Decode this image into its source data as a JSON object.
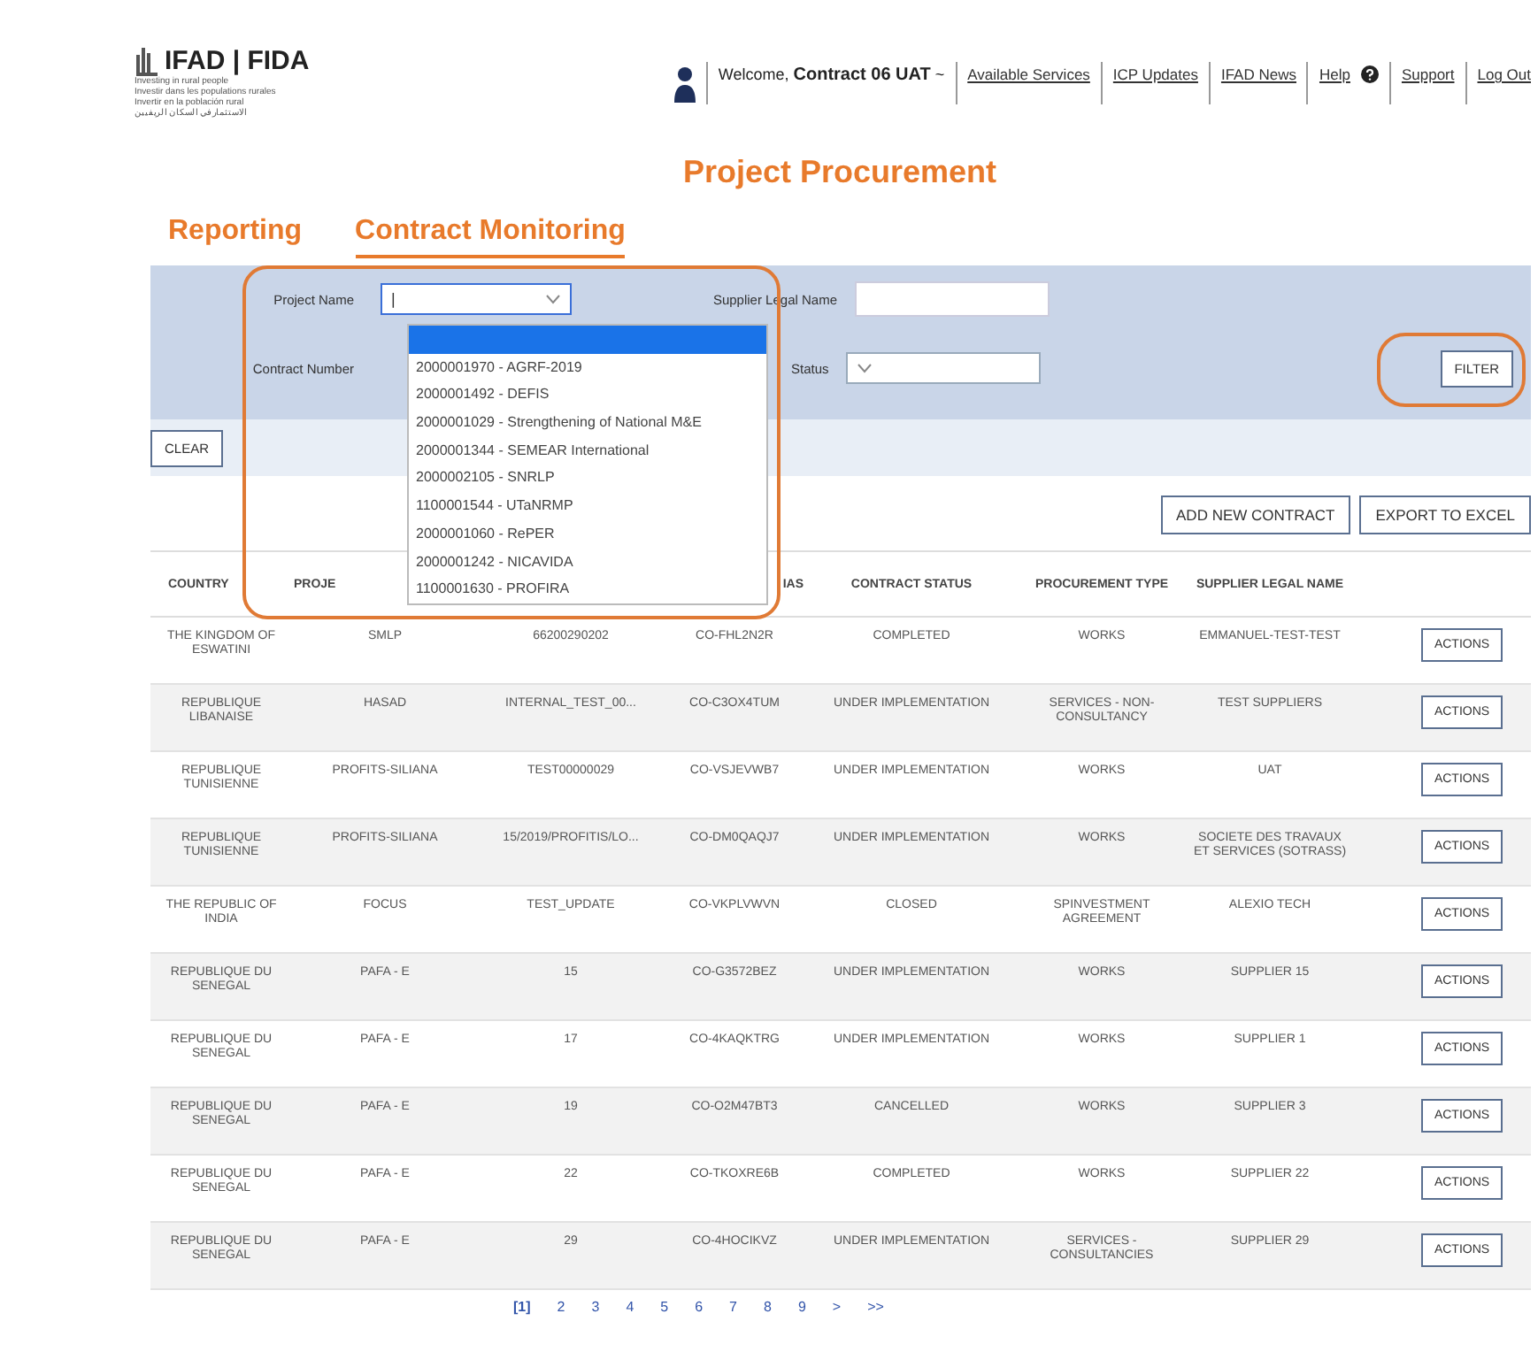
{
  "header": {
    "logo": "IFAD | FIDA",
    "taglines": [
      "Investing in rural people",
      "Investir dans les populations rurales",
      "Invertir en la población rural",
      "الاستثمار في السكان الريفيين"
    ],
    "welcome": "Welcome, **Contract 06 UAT** ~",
    "links": [
      "Available Services",
      "ICP Updates",
      "IFAD News",
      "Help",
      "Support",
      "Log Out"
    ]
  },
  "title": "Project Procurement",
  "tabs": [
    {
      "label": "Reporting",
      "selected": false
    },
    {
      "label": "Contract Monitoring",
      "selected": true
    }
  ],
  "filters": {
    "project_name": {
      "label": "Project Name",
      "value": "|"
    },
    "supplier_legal_name": {
      "label": "Supplier Legal Name"
    },
    "contract_number": {
      "label": "Contract Number"
    },
    "status": {
      "label": "Status"
    },
    "filter_button": "FILTER",
    "clear_button": "CLEAR",
    "dropdown_options": [
      {
        "selected": true
      },
      {
        "label": "2000001970 - AGRF-2019",
        "selected": false
      },
      {
        "label": "2000001492 - DEFIS",
        "selected": false
      },
      {
        "label": "2000001029 - Strengthening of National M&E",
        "selected": false
      },
      {
        "label": "2000001344 - SEMEAR International",
        "selected": false
      },
      {
        "label": "2000002105 - SNRLP",
        "selected": false
      },
      {
        "label": "1100001544 - UTaNRMP",
        "selected": false
      },
      {
        "label": "2000001060 - RePER",
        "selected": false
      },
      {
        "label": "2000001242 - NICAVIDA",
        "selected": false
      },
      {
        "label": "1100001630 - PROFIRA",
        "selected": false
      }
    ]
  },
  "actions": [
    "ADD NEW CONTRACT",
    "EXPORT TO EXCEL"
  ],
  "table": {
    "columns": [
      {
        "label": "COUNTRY"
      },
      {
        "label": "PROJE"
      },
      {},
      {
        "label": "IAS"
      },
      {
        "label": "CONTRACT STATUS"
      },
      {
        "label": "PROCUREMENT TYPE"
      },
      {
        "label": "SUPPLIER LEGAL NAME"
      },
      {}
    ],
    "rows": [
      [
        "THE KINGDOM OF ESWATINI",
        "SMLP",
        "66200290202",
        "CO-FHL2N2R",
        "COMPLETED",
        "WORKS",
        "EMMANUEL-TEST-TEST",
        "ACTIONS"
      ],
      [
        "REPUBLIQUE LIBANAISE",
        "HASAD",
        "INTERNAL_TEST_00...",
        "CO-C3OX4TUM",
        "UNDER IMPLEMENTATION",
        "SERVICES - NON-CONSULTANCY",
        "TEST SUPPLIERS",
        "ACTIONS"
      ],
      [
        "REPUBLIQUE TUNISIENNE",
        "PROFITS-SILIANA",
        "TEST00000029",
        "CO-VSJEVWB7",
        "UNDER IMPLEMENTATION",
        "WORKS",
        "UAT",
        "ACTIONS"
      ],
      [
        "REPUBLIQUE TUNISIENNE",
        "PROFITS-SILIANA",
        "15/2019/PROFITIS/LO...",
        "CO-DM0QAQJ7",
        "UNDER IMPLEMENTATION",
        "WORKS",
        "SOCIETE DES TRAVAUX ET SERVICES (SOTRASS)",
        "ACTIONS"
      ],
      [
        "THE REPUBLIC OF INDIA",
        "FOCUS",
        "TEST_UPDATE",
        "CO-VKPLVWVN",
        "CLOSED",
        "SPINVESTMENT AGREEMENT",
        "ALEXIO TECH",
        "ACTIONS"
      ],
      [
        "REPUBLIQUE DU SENEGAL",
        "PAFA - E",
        "15",
        "CO-G3572BEZ",
        "UNDER IMPLEMENTATION",
        "WORKS",
        "SUPPLIER 15",
        "ACTIONS"
      ],
      [
        "REPUBLIQUE DU SENEGAL",
        "PAFA - E",
        "17",
        "CO-4KAQKTRG",
        "UNDER IMPLEMENTATION",
        "WORKS",
        "SUPPLIER 1",
        "ACTIONS"
      ],
      [
        "REPUBLIQUE DU SENEGAL",
        "PAFA - E",
        "19",
        "CO-O2M47BT3",
        "CANCELLED",
        "WORKS",
        "SUPPLIER 3",
        "ACTIONS"
      ],
      [
        "REPUBLIQUE DU SENEGAL",
        "PAFA - E",
        "22",
        "CO-TKOXRE6B",
        "COMPLETED",
        "WORKS",
        "SUPPLIER 22",
        "ACTIONS"
      ],
      [
        "REPUBLIQUE DU SENEGAL",
        "PAFA - E",
        "29",
        "CO-4HOCIKVZ",
        "UNDER IMPLEMENTATION",
        "SERVICES - CONSULTANCIES",
        "SUPPLIER 29",
        "ACTIONS"
      ]
    ]
  },
  "pagination": [
    {
      "label": "[1]",
      "selected": true
    },
    {
      "label": "2",
      "selected": false
    },
    {
      "label": "3",
      "selected": false
    },
    {
      "label": "4",
      "selected": false
    },
    {
      "label": "5",
      "selected": false
    },
    {
      "label": "6",
      "selected": false
    },
    {
      "label": "7",
      "selected": false
    },
    {
      "label": "8",
      "selected": false
    },
    {
      "label": "9",
      "selected": false
    },
    {
      "label": ">",
      "selected": false
    },
    {
      "label": ">>",
      "selected": false
    }
  ]
}
